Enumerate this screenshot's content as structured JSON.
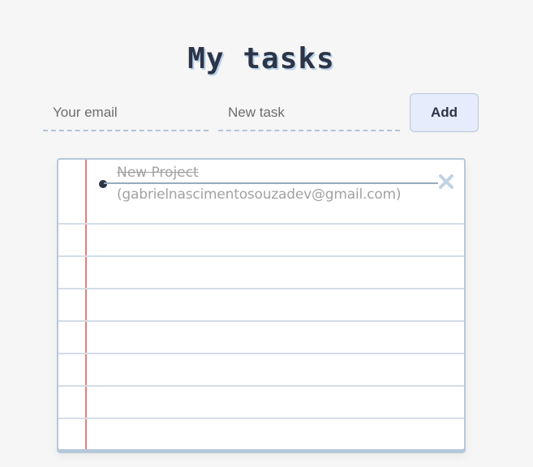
{
  "header": {
    "title": "My tasks"
  },
  "form": {
    "email_placeholder": "Your email",
    "task_placeholder": "New task",
    "email_value": "",
    "task_value": "",
    "add_label": "Add"
  },
  "tasks": [
    {
      "name": "New Project",
      "owner": "(gabrielnascimentosouzadev@gmail.com)",
      "completed": true,
      "delete_icon": "close-icon"
    }
  ],
  "colors": {
    "title": "#2c3447",
    "title_shadow": "#b9d2ea",
    "margin_line": "#e77d7d",
    "ruled_line": "#d3dde6",
    "add_button_bg": "#e5ecfb",
    "completed_text": "#a2a2a2"
  }
}
